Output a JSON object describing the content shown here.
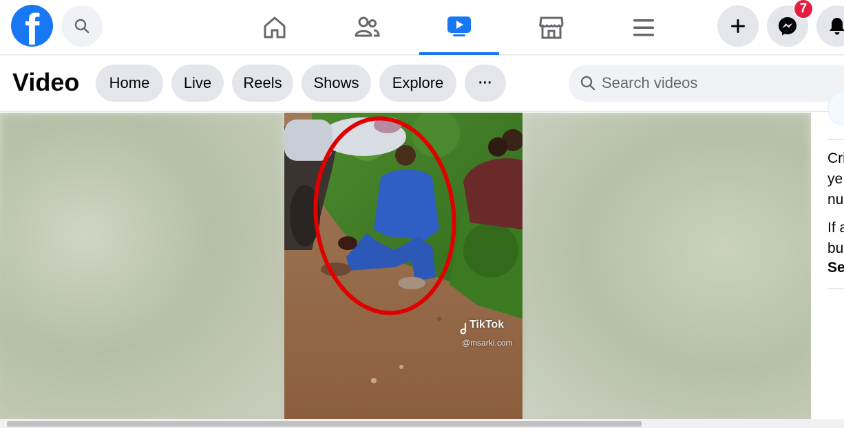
{
  "header": {
    "logo_letter": "f",
    "messenger_badge": "7",
    "nav": [
      {
        "name": "home",
        "active": false
      },
      {
        "name": "friends",
        "active": false
      },
      {
        "name": "video",
        "active": true
      },
      {
        "name": "marketplace",
        "active": false
      },
      {
        "name": "menu",
        "active": false
      }
    ],
    "accent_color": "#1877f2",
    "badge_color": "#e41e3f"
  },
  "subheader": {
    "title": "Video",
    "tabs": [
      "Home",
      "Live",
      "Reels",
      "Shows",
      "Explore"
    ],
    "more_label": "···",
    "search_placeholder": "Search videos"
  },
  "video": {
    "watermark": "TikTok",
    "handle": "@msarki.com",
    "annotation_color": "#e00000"
  },
  "sidebar": {
    "lines": [
      "Cri",
      "ye",
      "nu",
      "If a",
      "bu",
      "Se"
    ]
  }
}
